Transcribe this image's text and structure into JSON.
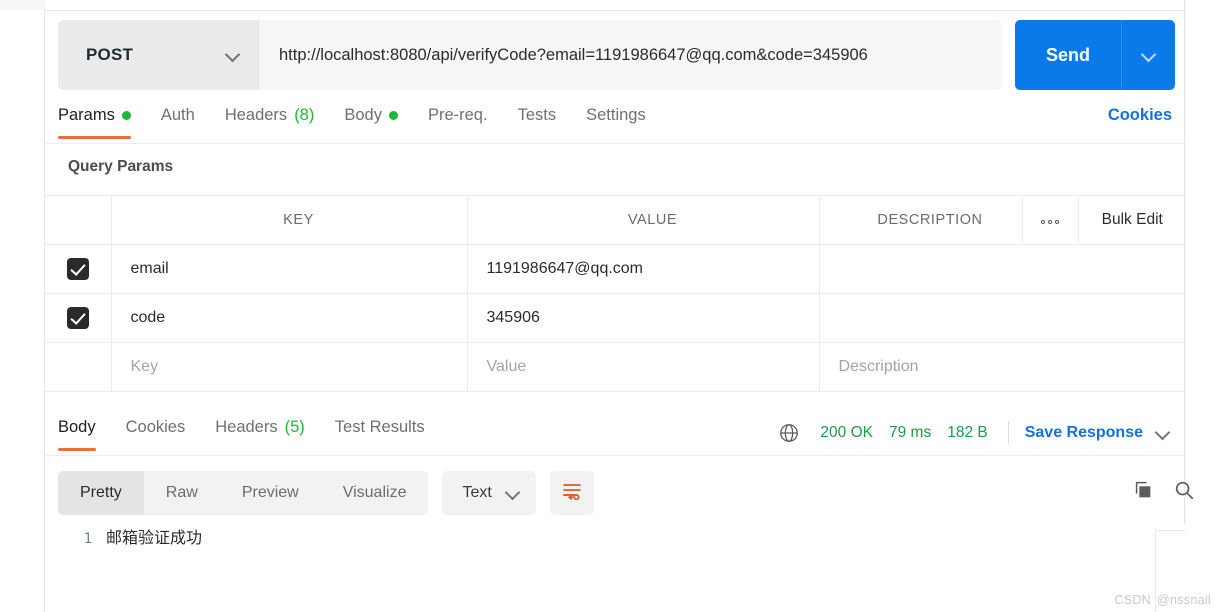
{
  "request": {
    "method": "POST",
    "method_caret_icon": "chevron-down-icon",
    "url": "http://localhost:8080/api/verifyCode?email=1191986647@qq.com&code=345906",
    "send_label": "Send",
    "send_caret_icon": "chevron-down-icon",
    "tabs": [
      {
        "label": "Params",
        "badge": "",
        "dot": true,
        "active": true
      },
      {
        "label": "Auth",
        "badge": "",
        "dot": false,
        "active": false
      },
      {
        "label": "Headers",
        "badge": "(8)",
        "dot": false,
        "active": false
      },
      {
        "label": "Body",
        "badge": "",
        "dot": true,
        "active": false
      },
      {
        "label": "Pre-req.",
        "badge": "",
        "dot": false,
        "active": false
      },
      {
        "label": "Tests",
        "badge": "",
        "dot": false,
        "active": false
      },
      {
        "label": "Settings",
        "badge": "",
        "dot": false,
        "active": false
      }
    ],
    "cookies_link": "Cookies"
  },
  "params": {
    "section_title": "Query Params",
    "columns": {
      "key": "KEY",
      "value": "VALUE",
      "description": "DESCRIPTION",
      "more_icon": "more-options-icon",
      "bulk_edit": "Bulk Edit"
    },
    "rows": [
      {
        "checked": true,
        "key": "email",
        "value": "1191986647@qq.com",
        "description": ""
      },
      {
        "checked": true,
        "key": "code",
        "value": "345906",
        "description": ""
      }
    ],
    "placeholder_row": {
      "key": "Key",
      "value": "Value",
      "description": "Description"
    }
  },
  "response": {
    "tabs": [
      {
        "label": "Body",
        "badge": "",
        "active": true
      },
      {
        "label": "Cookies",
        "badge": "",
        "active": false
      },
      {
        "label": "Headers",
        "badge": "(5)",
        "active": false
      },
      {
        "label": "Test Results",
        "badge": "",
        "active": false
      }
    ],
    "meta": {
      "globe_icon": "globe-icon",
      "status": "200 OK",
      "time": "79 ms",
      "size": "182 B",
      "save_label": "Save Response",
      "save_caret_icon": "chevron-down-icon"
    },
    "viewer": {
      "modes": [
        {
          "label": "Pretty",
          "active": true
        },
        {
          "label": "Raw",
          "active": false
        },
        {
          "label": "Preview",
          "active": false
        },
        {
          "label": "Visualize",
          "active": false
        }
      ],
      "format": "Text",
      "format_caret_icon": "chevron-down-icon",
      "wrap_icon": "word-wrap-icon",
      "copy_icon": "copy-icon",
      "search_icon": "search-icon"
    },
    "body": {
      "lines": [
        {
          "number": "1",
          "text": "邮箱验证成功"
        }
      ]
    }
  },
  "watermark": {
    "brand": "CSDN",
    "user": "@nssnail"
  },
  "colors": {
    "accent_blue": "#0a7aeb",
    "link_blue": "#1272e0",
    "status_green": "#1f9a4a",
    "dot_green": "#1bb934",
    "tab_underline": "#f26b3a"
  }
}
